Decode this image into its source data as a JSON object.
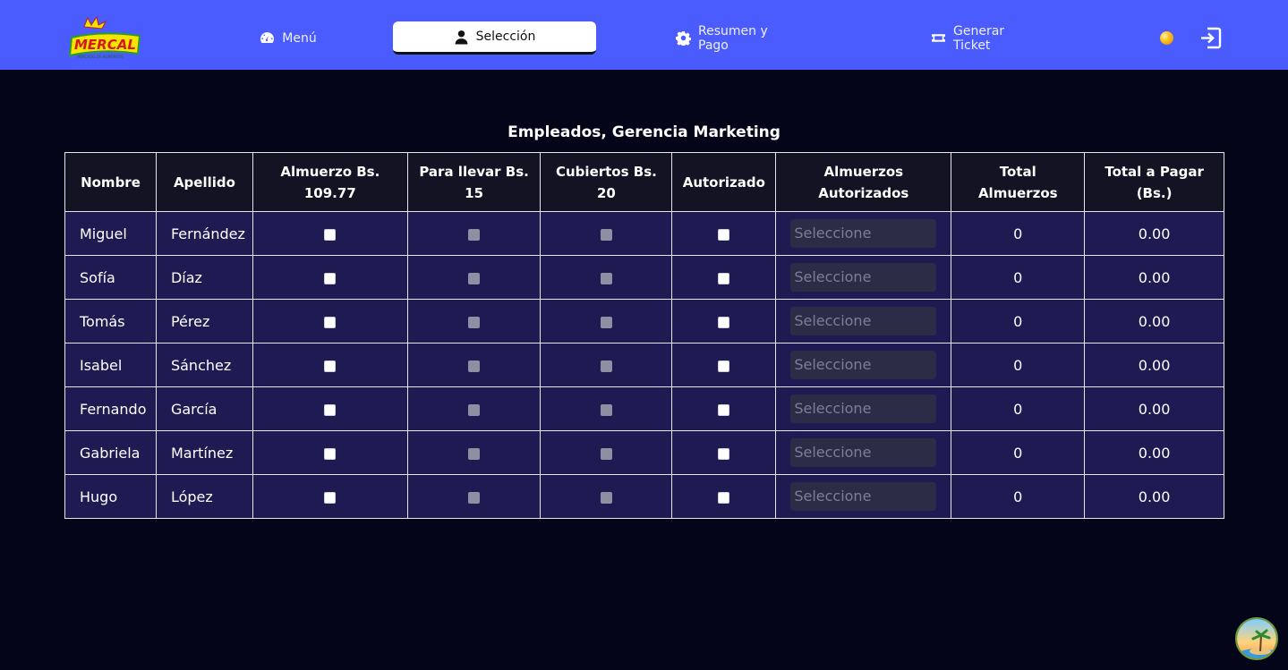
{
  "brand": {
    "logo_text": "MERCAL",
    "logo_subtext": "MERCADO DE ALIMENTOS"
  },
  "nav": {
    "items": [
      {
        "label": "Menú",
        "icon": "gauge-icon",
        "active": false
      },
      {
        "label": "Selección",
        "icon": "user-icon",
        "active": true
      },
      {
        "label": "Resumen y Pago",
        "icon": "gear-icon",
        "active": false
      },
      {
        "label": "Generar Ticket",
        "icon": "ticket-icon",
        "active": false
      }
    ]
  },
  "colors": {
    "navbar": "#4a5cfd",
    "page_bg": "#05051a",
    "row_bg": "#1d1b52",
    "header_bg": "#131323"
  },
  "page_title": "Empleados, Gerencia Marketing",
  "table": {
    "headers": {
      "nombre": "Nombre",
      "apellido": "Apellido",
      "almuerzo_1": "Almuerzo Bs.",
      "almuerzo_2": "109.77",
      "para_llevar_1": "Para llevar Bs.",
      "para_llevar_2": "15",
      "cubiertos_1": "Cubiertos Bs.",
      "cubiertos_2": "20",
      "autorizado": "Autorizado",
      "alm_aut_1": "Almuerzos",
      "alm_aut_2": "Autorizados",
      "total_alm_1": "Total",
      "total_alm_2": "Almuerzos",
      "total_pagar_1": "Total a Pagar",
      "total_pagar_2": "(Bs.)"
    },
    "select_placeholder": "Seleccione",
    "rows": [
      {
        "nombre": "Miguel",
        "apellido": "Fernández",
        "total_almuerzos": "0",
        "total_pagar": "0.00"
      },
      {
        "nombre": "Sofía",
        "apellido": "Díaz",
        "total_almuerzos": "0",
        "total_pagar": "0.00"
      },
      {
        "nombre": "Tomás",
        "apellido": "Pérez",
        "total_almuerzos": "0",
        "total_pagar": "0.00"
      },
      {
        "nombre": "Isabel",
        "apellido": "Sánchez",
        "total_almuerzos": "0",
        "total_pagar": "0.00"
      },
      {
        "nombre": "Fernando",
        "apellido": "García",
        "total_almuerzos": "0",
        "total_pagar": "0.00"
      },
      {
        "nombre": "Gabriela",
        "apellido": "Martínez",
        "total_almuerzos": "0",
        "total_pagar": "0.00"
      },
      {
        "nombre": "Hugo",
        "apellido": "López",
        "total_almuerzos": "0",
        "total_pagar": "0.00"
      }
    ]
  }
}
